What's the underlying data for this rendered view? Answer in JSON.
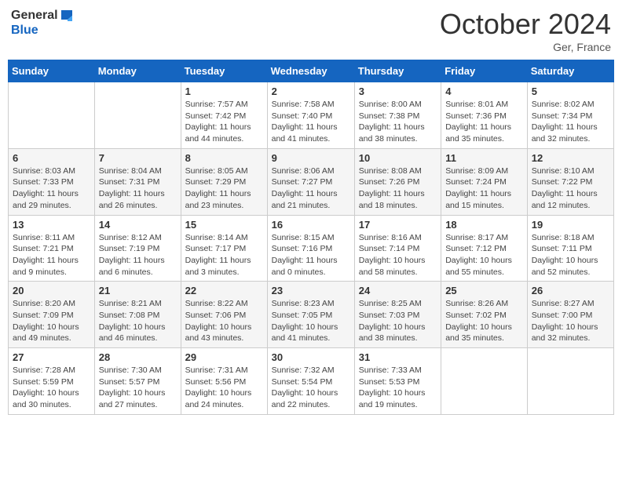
{
  "header": {
    "logo_line1": "General",
    "logo_line2": "Blue",
    "month": "October 2024",
    "location": "Ger, France"
  },
  "weekdays": [
    "Sunday",
    "Monday",
    "Tuesday",
    "Wednesday",
    "Thursday",
    "Friday",
    "Saturday"
  ],
  "weeks": [
    [
      null,
      null,
      {
        "day": 1,
        "sunrise": "Sunrise: 7:57 AM",
        "sunset": "Sunset: 7:42 PM",
        "daylight": "Daylight: 11 hours and 44 minutes."
      },
      {
        "day": 2,
        "sunrise": "Sunrise: 7:58 AM",
        "sunset": "Sunset: 7:40 PM",
        "daylight": "Daylight: 11 hours and 41 minutes."
      },
      {
        "day": 3,
        "sunrise": "Sunrise: 8:00 AM",
        "sunset": "Sunset: 7:38 PM",
        "daylight": "Daylight: 11 hours and 38 minutes."
      },
      {
        "day": 4,
        "sunrise": "Sunrise: 8:01 AM",
        "sunset": "Sunset: 7:36 PM",
        "daylight": "Daylight: 11 hours and 35 minutes."
      },
      {
        "day": 5,
        "sunrise": "Sunrise: 8:02 AM",
        "sunset": "Sunset: 7:34 PM",
        "daylight": "Daylight: 11 hours and 32 minutes."
      }
    ],
    [
      {
        "day": 6,
        "sunrise": "Sunrise: 8:03 AM",
        "sunset": "Sunset: 7:33 PM",
        "daylight": "Daylight: 11 hours and 29 minutes."
      },
      {
        "day": 7,
        "sunrise": "Sunrise: 8:04 AM",
        "sunset": "Sunset: 7:31 PM",
        "daylight": "Daylight: 11 hours and 26 minutes."
      },
      {
        "day": 8,
        "sunrise": "Sunrise: 8:05 AM",
        "sunset": "Sunset: 7:29 PM",
        "daylight": "Daylight: 11 hours and 23 minutes."
      },
      {
        "day": 9,
        "sunrise": "Sunrise: 8:06 AM",
        "sunset": "Sunset: 7:27 PM",
        "daylight": "Daylight: 11 hours and 21 minutes."
      },
      {
        "day": 10,
        "sunrise": "Sunrise: 8:08 AM",
        "sunset": "Sunset: 7:26 PM",
        "daylight": "Daylight: 11 hours and 18 minutes."
      },
      {
        "day": 11,
        "sunrise": "Sunrise: 8:09 AM",
        "sunset": "Sunset: 7:24 PM",
        "daylight": "Daylight: 11 hours and 15 minutes."
      },
      {
        "day": 12,
        "sunrise": "Sunrise: 8:10 AM",
        "sunset": "Sunset: 7:22 PM",
        "daylight": "Daylight: 11 hours and 12 minutes."
      }
    ],
    [
      {
        "day": 13,
        "sunrise": "Sunrise: 8:11 AM",
        "sunset": "Sunset: 7:21 PM",
        "daylight": "Daylight: 11 hours and 9 minutes."
      },
      {
        "day": 14,
        "sunrise": "Sunrise: 8:12 AM",
        "sunset": "Sunset: 7:19 PM",
        "daylight": "Daylight: 11 hours and 6 minutes."
      },
      {
        "day": 15,
        "sunrise": "Sunrise: 8:14 AM",
        "sunset": "Sunset: 7:17 PM",
        "daylight": "Daylight: 11 hours and 3 minutes."
      },
      {
        "day": 16,
        "sunrise": "Sunrise: 8:15 AM",
        "sunset": "Sunset: 7:16 PM",
        "daylight": "Daylight: 11 hours and 0 minutes."
      },
      {
        "day": 17,
        "sunrise": "Sunrise: 8:16 AM",
        "sunset": "Sunset: 7:14 PM",
        "daylight": "Daylight: 10 hours and 58 minutes."
      },
      {
        "day": 18,
        "sunrise": "Sunrise: 8:17 AM",
        "sunset": "Sunset: 7:12 PM",
        "daylight": "Daylight: 10 hours and 55 minutes."
      },
      {
        "day": 19,
        "sunrise": "Sunrise: 8:18 AM",
        "sunset": "Sunset: 7:11 PM",
        "daylight": "Daylight: 10 hours and 52 minutes."
      }
    ],
    [
      {
        "day": 20,
        "sunrise": "Sunrise: 8:20 AM",
        "sunset": "Sunset: 7:09 PM",
        "daylight": "Daylight: 10 hours and 49 minutes."
      },
      {
        "day": 21,
        "sunrise": "Sunrise: 8:21 AM",
        "sunset": "Sunset: 7:08 PM",
        "daylight": "Daylight: 10 hours and 46 minutes."
      },
      {
        "day": 22,
        "sunrise": "Sunrise: 8:22 AM",
        "sunset": "Sunset: 7:06 PM",
        "daylight": "Daylight: 10 hours and 43 minutes."
      },
      {
        "day": 23,
        "sunrise": "Sunrise: 8:23 AM",
        "sunset": "Sunset: 7:05 PM",
        "daylight": "Daylight: 10 hours and 41 minutes."
      },
      {
        "day": 24,
        "sunrise": "Sunrise: 8:25 AM",
        "sunset": "Sunset: 7:03 PM",
        "daylight": "Daylight: 10 hours and 38 minutes."
      },
      {
        "day": 25,
        "sunrise": "Sunrise: 8:26 AM",
        "sunset": "Sunset: 7:02 PM",
        "daylight": "Daylight: 10 hours and 35 minutes."
      },
      {
        "day": 26,
        "sunrise": "Sunrise: 8:27 AM",
        "sunset": "Sunset: 7:00 PM",
        "daylight": "Daylight: 10 hours and 32 minutes."
      }
    ],
    [
      {
        "day": 27,
        "sunrise": "Sunrise: 7:28 AM",
        "sunset": "Sunset: 5:59 PM",
        "daylight": "Daylight: 10 hours and 30 minutes."
      },
      {
        "day": 28,
        "sunrise": "Sunrise: 7:30 AM",
        "sunset": "Sunset: 5:57 PM",
        "daylight": "Daylight: 10 hours and 27 minutes."
      },
      {
        "day": 29,
        "sunrise": "Sunrise: 7:31 AM",
        "sunset": "Sunset: 5:56 PM",
        "daylight": "Daylight: 10 hours and 24 minutes."
      },
      {
        "day": 30,
        "sunrise": "Sunrise: 7:32 AM",
        "sunset": "Sunset: 5:54 PM",
        "daylight": "Daylight: 10 hours and 22 minutes."
      },
      {
        "day": 31,
        "sunrise": "Sunrise: 7:33 AM",
        "sunset": "Sunset: 5:53 PM",
        "daylight": "Daylight: 10 hours and 19 minutes."
      },
      null,
      null
    ]
  ]
}
